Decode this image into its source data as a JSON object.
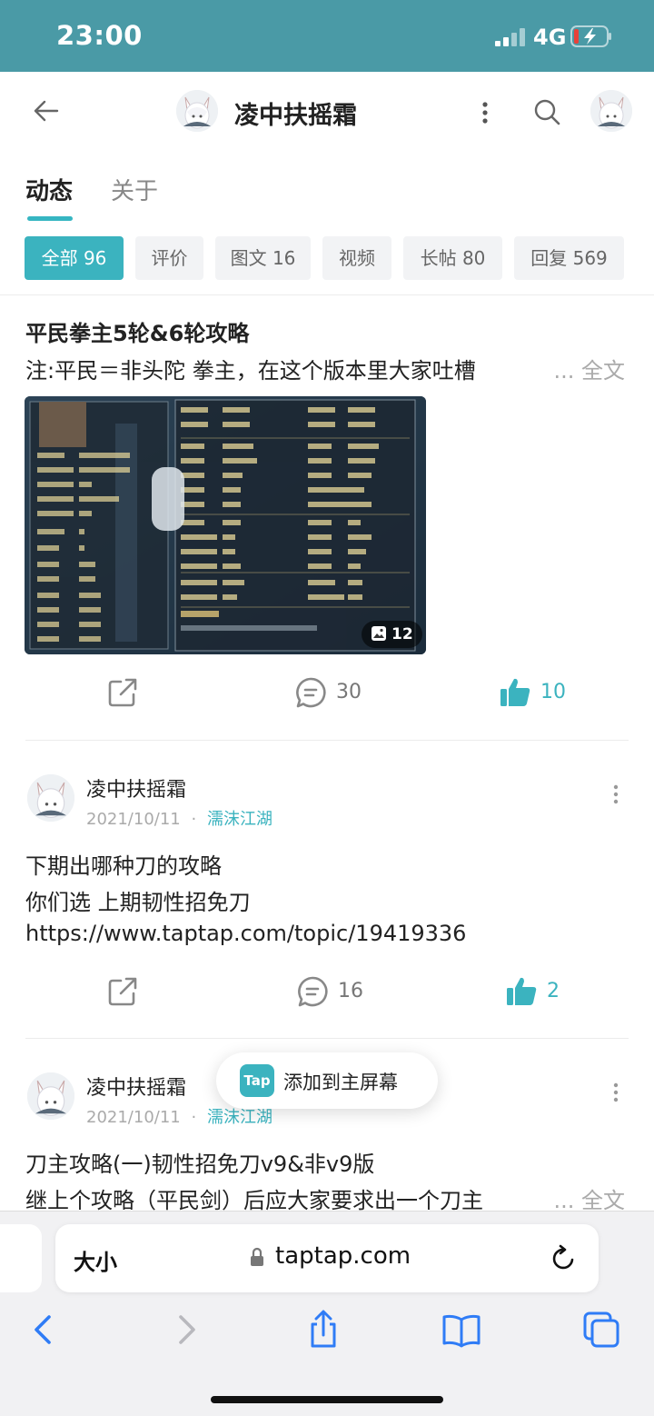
{
  "status_bar": {
    "time": "23:00",
    "network": "4G"
  },
  "header": {
    "title": "凌中扶摇霜"
  },
  "tabs": [
    {
      "label": "动态",
      "active": true
    },
    {
      "label": "关于",
      "active": false
    }
  ],
  "filters": [
    {
      "label": "全部 96",
      "active": true
    },
    {
      "label": "评价",
      "active": false
    },
    {
      "label": "图文 16",
      "active": false
    },
    {
      "label": "视频",
      "active": false
    },
    {
      "label": "长帖 80",
      "active": false
    },
    {
      "label": "回复 569",
      "active": false
    }
  ],
  "posts": [
    {
      "title": "平民拳主5轮&6轮攻略",
      "excerpt": "注:平民＝非头陀 拳主，在这个版本里大家吐槽",
      "more_label": "... 全文",
      "image_count": "12",
      "comments": "30",
      "likes": "10"
    },
    {
      "author": "凌中扶摇霜",
      "date": "2021/10/11",
      "separator": "·",
      "forum": "濡沫江湖",
      "lines": [
        "下期出哪种刀的攻略",
        "你们选 上期韧性招免刀",
        "https://www.taptap.com/topic/19419336"
      ],
      "comments": "16",
      "likes": "2"
    },
    {
      "author": "凌中扶摇霜",
      "date": "2021/10/11",
      "separator": "·",
      "forum": "濡沫江湖",
      "title": "刀主攻略(一)韧性招免刀v9&非v9版",
      "excerpt": "继上个攻略（平民剑）后应大家要求出一个刀主",
      "more_label": "... 全文"
    }
  ],
  "toast": {
    "logo": "Tap",
    "text": "添加到主屏幕"
  },
  "browser": {
    "text_size": "大小",
    "url": "taptap.com"
  },
  "colors": {
    "accent": "#3bb3bf",
    "status_bar": "#4a9aa6"
  }
}
